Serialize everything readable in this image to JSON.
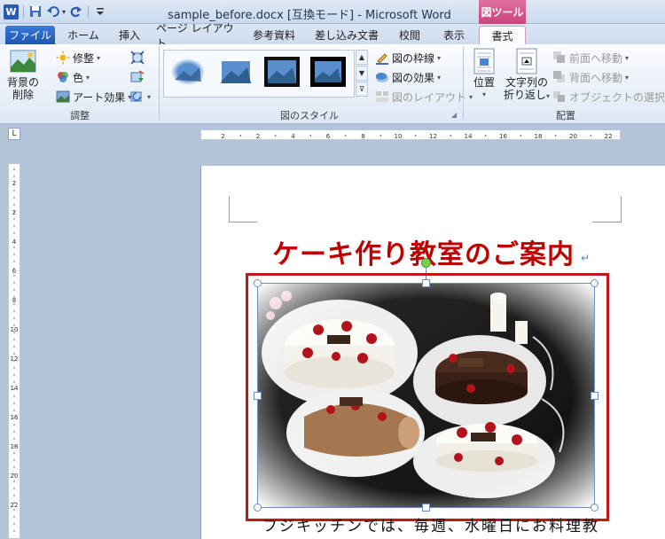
{
  "titlebar": {
    "title": "sample_before.docx [互換モード] - Microsoft Word",
    "context_label": "図ツール",
    "word_logo": "W",
    "qat_icons": [
      "word-icon",
      "save-icon",
      "undo-icon",
      "redo-icon",
      "customize-icon"
    ]
  },
  "tabs": [
    "ファイル",
    "ホーム",
    "挿入",
    "ページ レイアウト",
    "参考資料",
    "差し込み文書",
    "校閲",
    "表示",
    "書式"
  ],
  "active_tab": "書式",
  "ribbon": {
    "adjust": {
      "remove_bg_line1": "背景の",
      "remove_bg_line2": "削除",
      "corrections": "修整",
      "color": "色",
      "artistic": "アート効果",
      "label": "調整"
    },
    "styles": {
      "border": "図の枠線",
      "effects": "図の効果",
      "layout": "図のレイアウト",
      "label": "図のスタイル"
    },
    "arrange": {
      "position": "位置",
      "wrap_line1": "文字列の",
      "wrap_line2": "折り返し",
      "bring_forward": "前面へ移動",
      "send_backward": "背面へ移動",
      "selection_pane": "オブジェクトの選択と表示",
      "label": "配置"
    }
  },
  "ruler": {
    "ticks": [
      "2",
      "2",
      "4",
      "6",
      "8",
      "10",
      "12",
      "14",
      "16",
      "18",
      "20",
      "22"
    ],
    "vticks": [
      "2",
      "2",
      "4",
      "6",
      "8",
      "10",
      "12",
      "14",
      "16",
      "18",
      "20",
      "22",
      "24"
    ],
    "corner": "L"
  },
  "document": {
    "title": "ケーキ作り教室のご案内",
    "para_mark": "↵",
    "body": "フジキッチンでは、毎週、水曜日にお料理教"
  },
  "colors": {
    "title_red": "#c00000",
    "highlight_red": "#c01818",
    "file_tab": "#1e55b3",
    "context_pink": "#c9447c"
  }
}
